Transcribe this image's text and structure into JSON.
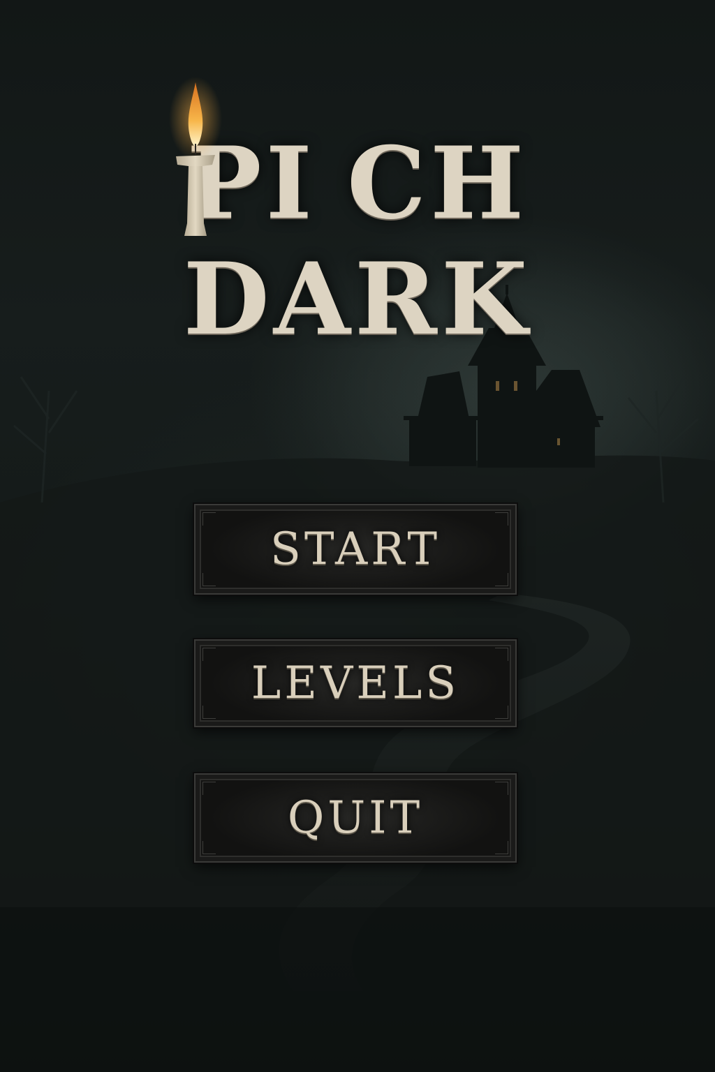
{
  "game": {
    "title_part1": "PI",
    "title_part2": "CH",
    "title_part3": "DARK"
  },
  "menu": {
    "items": [
      {
        "label": "START"
      },
      {
        "label": "LEVELS"
      },
      {
        "label": "QUIT"
      }
    ]
  },
  "colors": {
    "background": "#121716",
    "title_text": "#ddd4c2",
    "button_text": "#d9cfbb",
    "button_fill": "#141413",
    "button_border": "#3a3a38",
    "flame": "#f2a23a",
    "candle_wax": "#d8cdb6"
  },
  "icons": {
    "title_letter_t": "candle-icon",
    "background": "haunted-house-silhouette"
  }
}
